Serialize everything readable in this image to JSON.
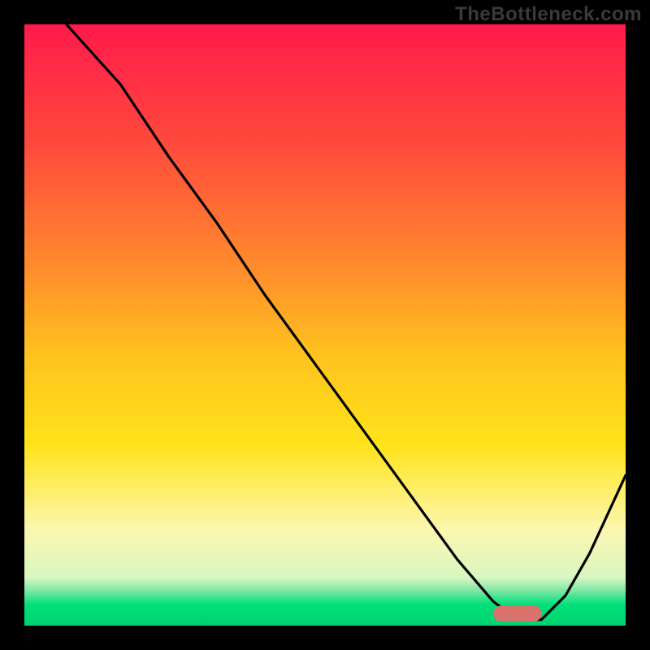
{
  "watermark": "TheBottleneck.com",
  "chart_data": {
    "type": "line",
    "title": "",
    "xlabel": "",
    "ylabel": "",
    "xlim": [
      0,
      100
    ],
    "ylim": [
      0,
      100
    ],
    "grid": false,
    "legend": false,
    "background_gradient": {
      "stops": [
        {
          "offset": 0.0,
          "color": "#ff1a4b"
        },
        {
          "offset": 0.2,
          "color": "#ff4a3c"
        },
        {
          "offset": 0.4,
          "color": "#ff8a2d"
        },
        {
          "offset": 0.55,
          "color": "#ffc21e"
        },
        {
          "offset": 0.7,
          "color": "#ffe31a"
        },
        {
          "offset": 0.84,
          "color": "#fcf7b0"
        },
        {
          "offset": 0.92,
          "color": "#d8f7c0"
        },
        {
          "offset": 0.94,
          "color": "#86e8a8"
        },
        {
          "offset": 0.965,
          "color": "#00e07a"
        },
        {
          "offset": 1.0,
          "color": "#00d270"
        }
      ]
    },
    "series": [
      {
        "name": "bottleneck-curve",
        "type": "line",
        "color": "#000000",
        "x": [
          7,
          16,
          24,
          32,
          40,
          48,
          56,
          64,
          72,
          78,
          82,
          86,
          90,
          94,
          100
        ],
        "y": [
          100,
          90,
          78,
          67,
          55,
          44,
          33,
          22,
          11,
          4,
          1,
          1,
          5,
          12,
          25
        ]
      }
    ],
    "marker": {
      "name": "optimal-range",
      "color": "#d9736b",
      "x_start": 78,
      "x_end": 86,
      "y": 2,
      "thickness": 2.6
    }
  }
}
